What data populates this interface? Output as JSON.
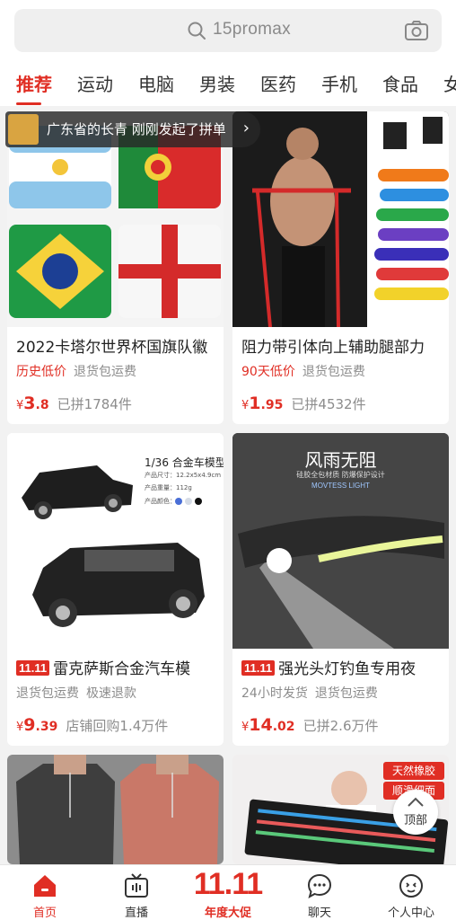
{
  "search": {
    "query": "15promax"
  },
  "tabs": [
    "推荐",
    "运动",
    "电脑",
    "男装",
    "医药",
    "手机",
    "食品",
    "女"
  ],
  "notice": {
    "text": "广东省的长青 刚刚发起了拼单",
    "chevron": "›"
  },
  "products": [
    {
      "title": "2022卡塔尔世界杯国旗队徽",
      "badge": "",
      "tags": [
        {
          "text": "历史低价",
          "style": "red"
        },
        {
          "text": "退货包运费",
          "style": "gray"
        }
      ],
      "price_symbol": "¥",
      "price_int": "3",
      "price_dec": ".8",
      "sold": "已拼1784件",
      "image": "flag-pillows"
    },
    {
      "title": "阻力带引体向上辅助腿部力",
      "badge": "",
      "tags": [
        {
          "text": "90天低价",
          "style": "red"
        },
        {
          "text": "退货包运费",
          "style": "gray"
        }
      ],
      "price_symbol": "¥",
      "price_int": "1",
      "price_dec": ".95",
      "sold": "已拼4532件",
      "image": "resistance-bands"
    },
    {
      "title": "雷克萨斯合金汽车模",
      "badge": "11.11",
      "tags": [
        {
          "text": "退货包运费",
          "style": "gray"
        },
        {
          "text": "极速退款",
          "style": "gray"
        }
      ],
      "price_symbol": "¥",
      "price_int": "9",
      "price_dec": ".39",
      "sold": "店铺回购1.4万件",
      "image": "car-model",
      "image_text": {
        "model_title": "1/36 合金车模型",
        "size": "产品尺寸：12.2x5x4.9cm",
        "weight": "产品重量：112g",
        "colors": "产品颜色："
      }
    },
    {
      "title": "强光头灯钓鱼专用夜",
      "badge": "11.11",
      "tags": [
        {
          "text": "24小时发货",
          "style": "gray"
        },
        {
          "text": "退货包运费",
          "style": "gray"
        }
      ],
      "price_symbol": "¥",
      "price_int": "14",
      "price_dec": ".02",
      "sold": "已拼2.6万件",
      "image": "headlamp",
      "image_text": {
        "headline": "风雨无阻",
        "sub": "硅胶全包材质 防爆保护设计",
        "brand": "MOVTESS LIGHT"
      }
    },
    {
      "image": "tank-tops"
    },
    {
      "image": "keyboard",
      "image_text": {
        "line1": "天然橡胶",
        "line2": "顺滑细面"
      }
    }
  ],
  "to_top": {
    "label": "顶部"
  },
  "bottom_nav": {
    "home": "首页",
    "live": "直播",
    "promo_big": "11.11",
    "promo": "年度大促",
    "chat": "聊天",
    "me": "个人中心"
  },
  "colors": {
    "accent": "#e02e24",
    "background": "#f2f2f2"
  }
}
